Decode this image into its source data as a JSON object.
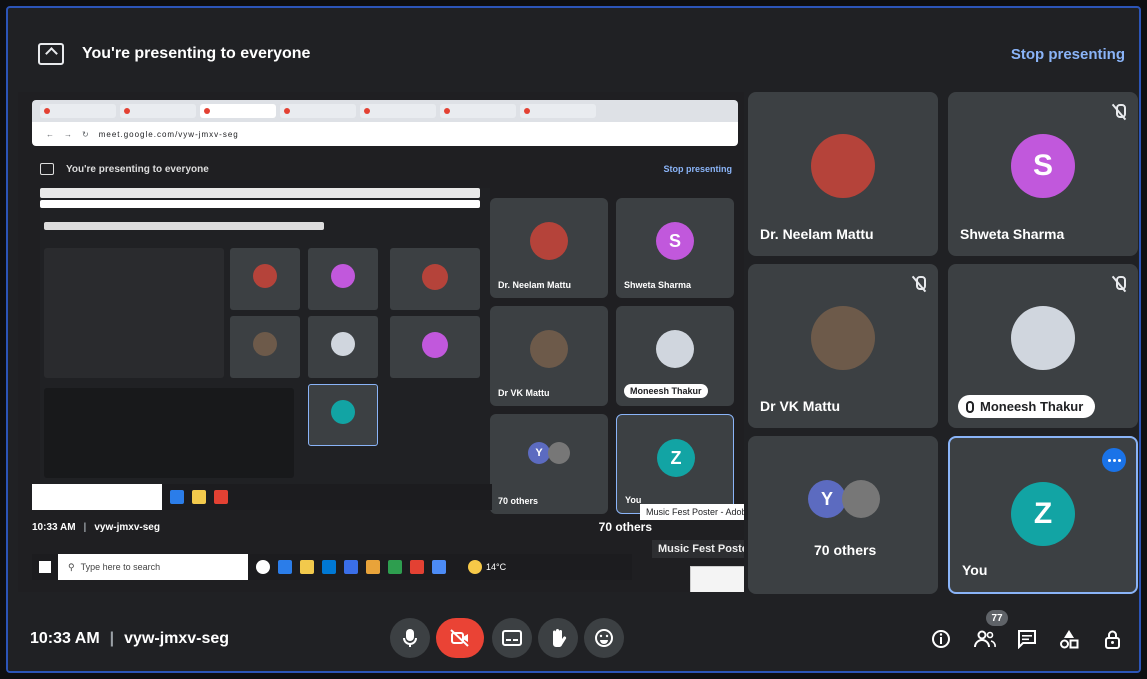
{
  "banner": {
    "title": "You're presenting to everyone",
    "stop_label": "Stop presenting"
  },
  "shared_screen": {
    "nested_banner": "You're presenting to everyone",
    "nested_stop": "Stop presenting",
    "browser": {
      "url": "meet.google.com/vyw-jmxv-seg"
    },
    "tiles": [
      {
        "name": "Dr. Neelam Mattu"
      },
      {
        "name": "Shweta Sharma",
        "initial": "S"
      },
      {
        "name": "Dr VK Mattu"
      },
      {
        "name": "Moneesh Thakur"
      },
      {
        "name": "You",
        "initial": "Z"
      },
      {
        "name": "70 others"
      }
    ],
    "popup1": "Music Fest Poster - Adobe Reader",
    "popup2": "Music Fest Poster - Adobe Read...",
    "inner_clock": "10:33 AM",
    "inner_code": "vyw-jmxv-seg",
    "taskbar_search": "Type here to search",
    "temperature": "14°C",
    "others_label": "70 others"
  },
  "participants": [
    {
      "name": "Dr. Neelam Mattu",
      "muted": false
    },
    {
      "name": "Shweta Sharma",
      "initial": "S",
      "color": "#c158dc",
      "muted": true
    },
    {
      "name": "Dr VK Mattu",
      "muted": true
    },
    {
      "name": "Moneesh Thakur",
      "muted": true
    },
    {
      "name": "70 others",
      "initial": "Y"
    },
    {
      "name": "You",
      "initial": "Z",
      "color": "#12a4a4"
    }
  ],
  "bottom_bar": {
    "time": "10:33 AM",
    "separator": "|",
    "meeting_code": "vyw-jmxv-seg",
    "people_count": "77"
  },
  "colors": {
    "accent": "#8ab4f8",
    "end_call": "#ea4335",
    "you_border": "#8ab4f8"
  }
}
